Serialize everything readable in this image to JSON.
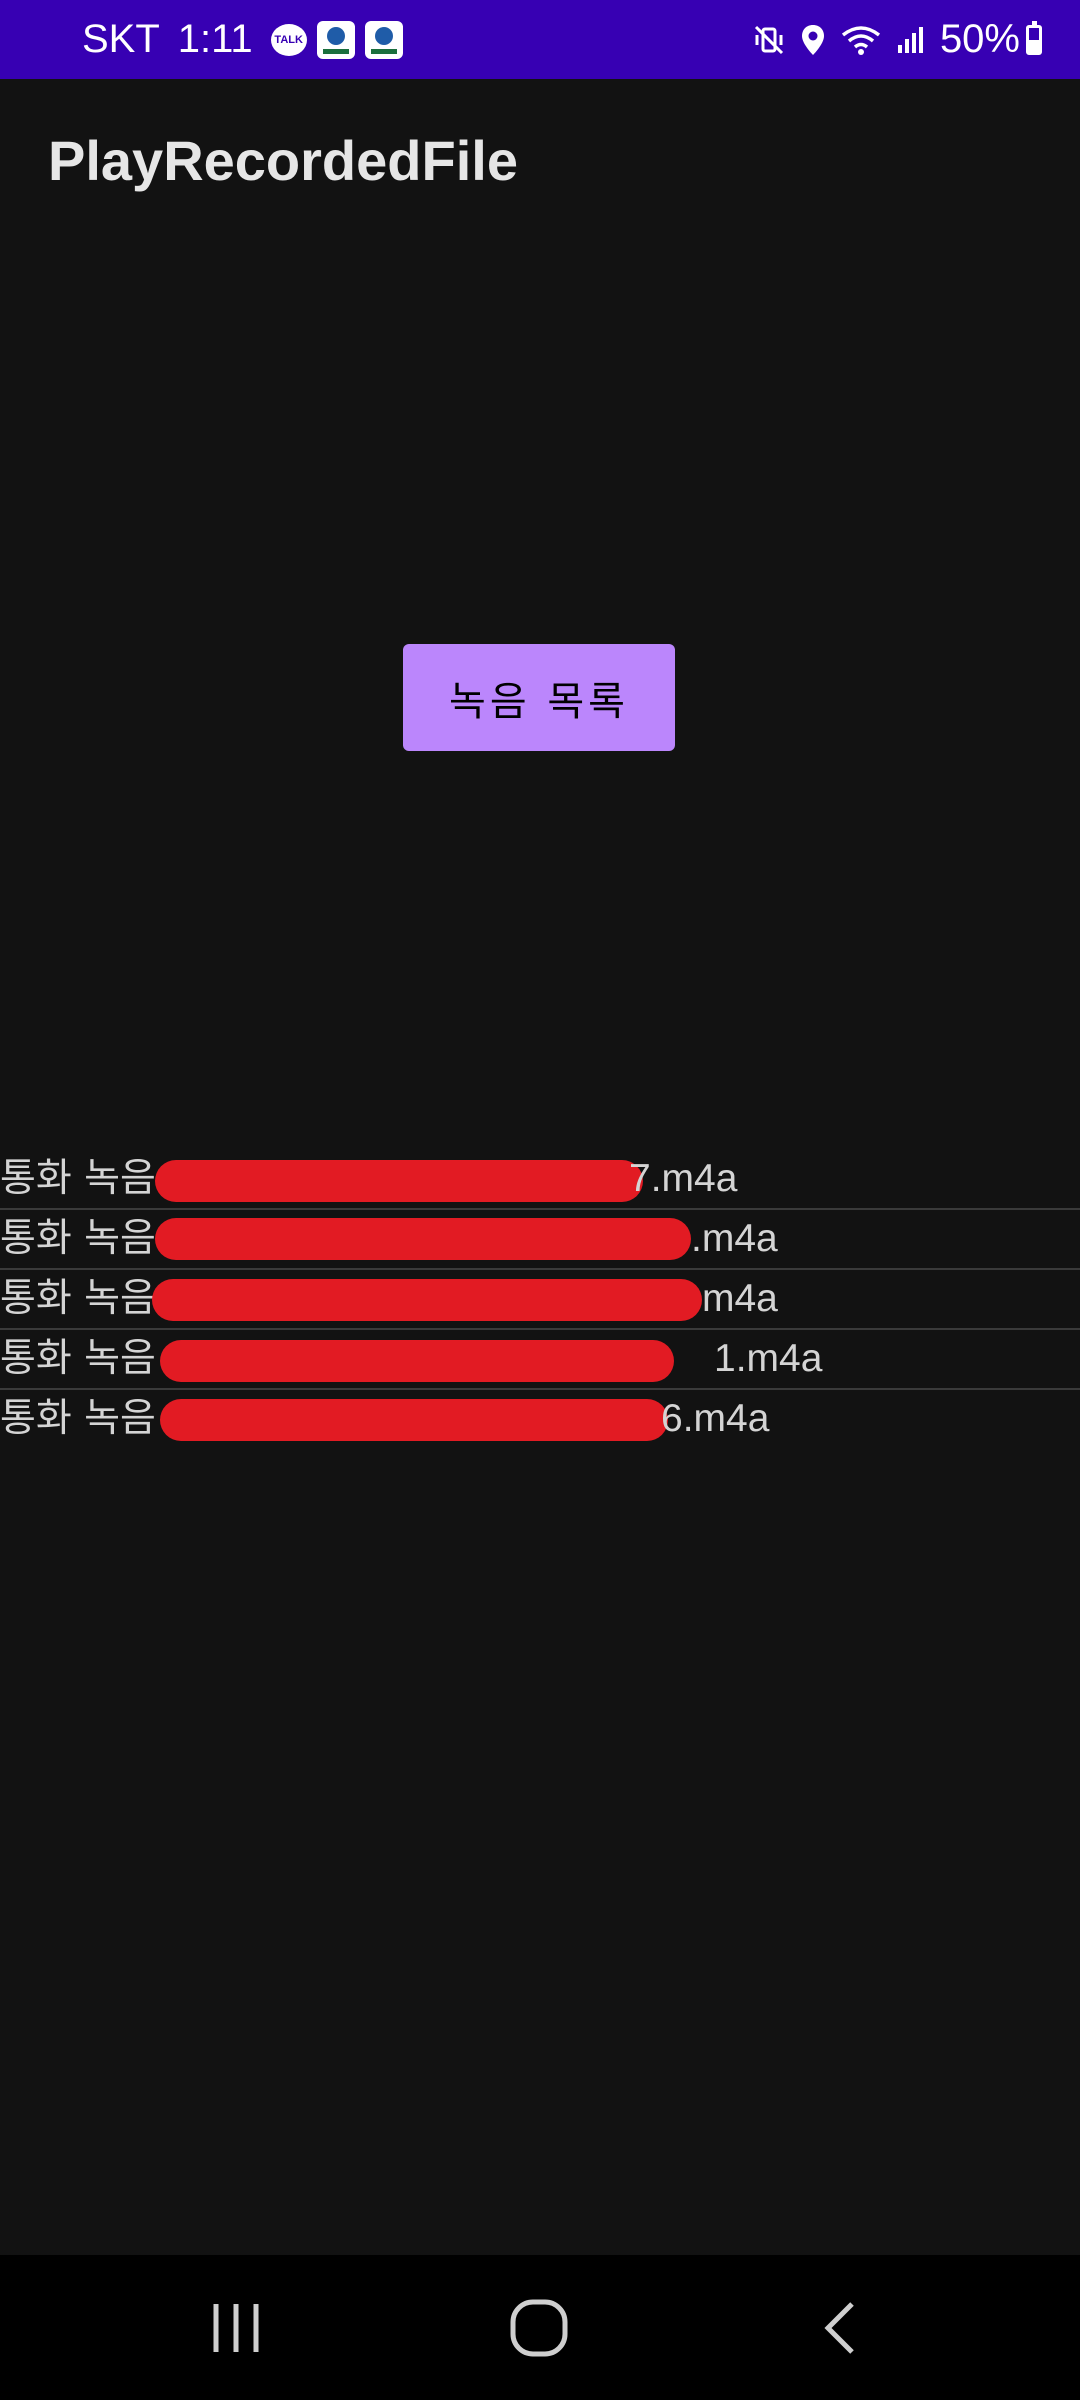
{
  "status_bar": {
    "carrier": "SKT",
    "time": "1:11",
    "notifications": [
      "talk-icon",
      "app-icon",
      "app-icon"
    ],
    "talk_label": "TALK",
    "battery_percent": "50%",
    "battery_level": 0.5,
    "icons": [
      "vibrate-mute-icon",
      "location-icon",
      "wifi-icon",
      "signal-icon",
      "battery-charging-icon"
    ]
  },
  "app_bar": {
    "title": "PlayRecordedFile"
  },
  "main": {
    "list_button_label": "녹음 목록"
  },
  "files": [
    {
      "prefix": "통화 녹음",
      "suffix": "7.m4a"
    },
    {
      "prefix": "통화 녹음",
      "suffix": ".m4a"
    },
    {
      "prefix": "통화 녹음",
      "suffix": "m4a"
    },
    {
      "prefix": "통화 녹음",
      "suffix": "1.m4a"
    },
    {
      "prefix": "통화 녹음",
      "suffix": "6.m4a"
    }
  ],
  "nav_bar": {
    "buttons": [
      "recent-apps-icon",
      "home-icon",
      "back-icon"
    ]
  },
  "colors": {
    "status_bar": "#3700b3",
    "background": "#121212",
    "button": "#bb86fc",
    "redaction": "#e21b23"
  }
}
